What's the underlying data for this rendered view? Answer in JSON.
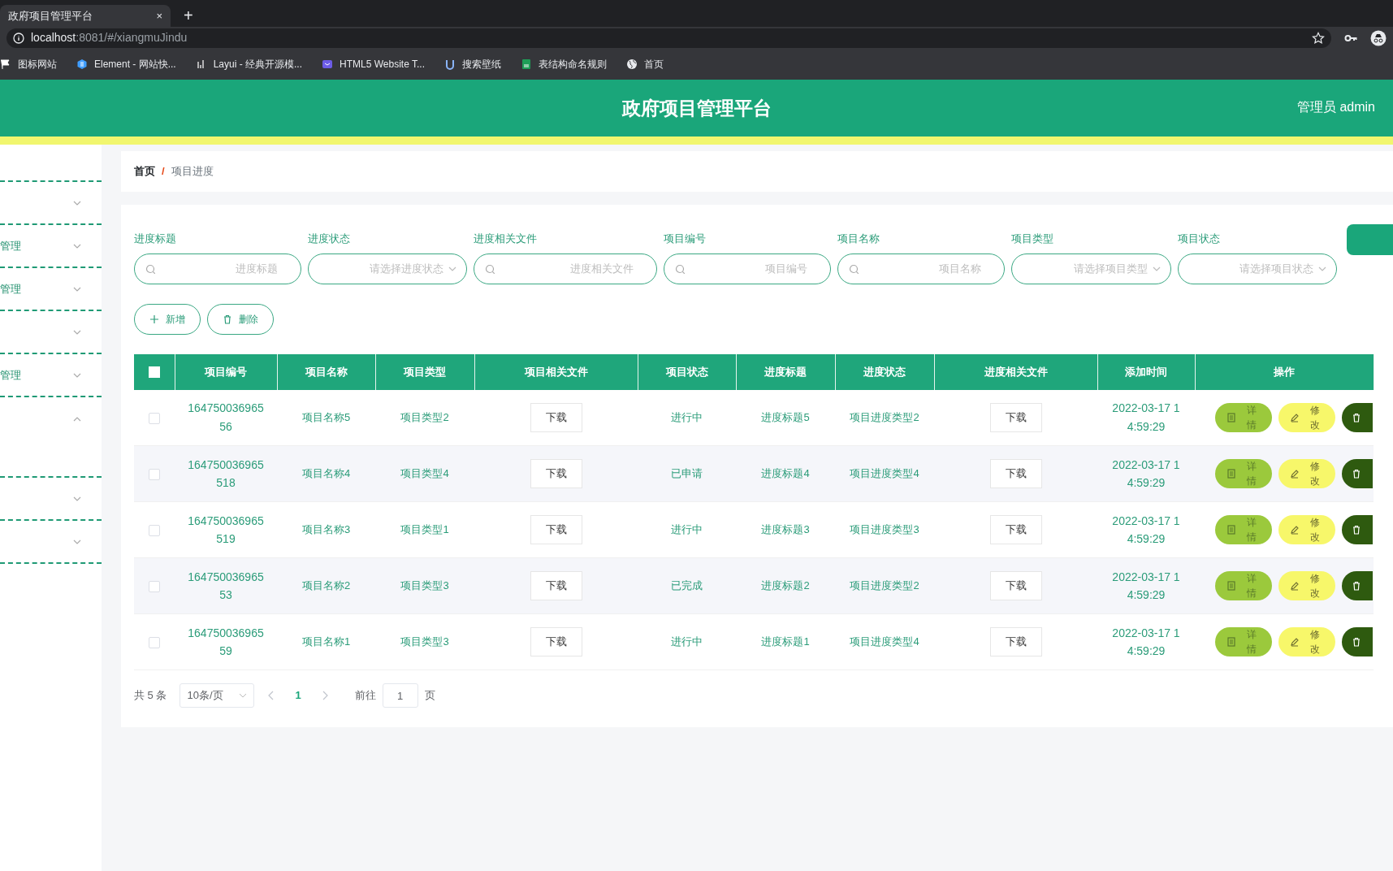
{
  "browser": {
    "tab_title": "政府项目管理平台",
    "tab_close": "×",
    "new_tab": "+",
    "address_host": "localhost",
    "address_rest": ":8081/#/xiangmuJindu",
    "bookmarks": [
      {
        "label": "图标网站",
        "kind": "flag"
      },
      {
        "label": "Element - 网站快...",
        "kind": "hexagon"
      },
      {
        "label": "Layui - 经典开源模...",
        "kind": "bars"
      },
      {
        "label": "HTML5 Website T...",
        "kind": "cat"
      },
      {
        "label": "搜索壁纸",
        "kind": "u"
      },
      {
        "label": "表结构命名规则",
        "kind": "sheet"
      },
      {
        "label": "首页",
        "kind": "globe"
      }
    ]
  },
  "header": {
    "title": "政府项目管理平台",
    "user": "管理员 admin"
  },
  "sidebar": {
    "items": [
      {
        "expanded": false
      },
      {
        "label": "管理",
        "expanded": false
      },
      {
        "label": "管理",
        "expanded": false
      },
      {
        "expanded": false
      },
      {
        "label": "管理",
        "expanded": false
      },
      {
        "expanded": true
      },
      {
        "expanded": false
      },
      {
        "expanded": false
      }
    ]
  },
  "breadcrumb": {
    "items": [
      "首页",
      "项目进度"
    ],
    "separator": "/"
  },
  "filters": [
    {
      "label": "进度标题",
      "placeholder": "进度标题",
      "kind": "search"
    },
    {
      "label": "进度状态",
      "placeholder": "请选择进度状态",
      "kind": "select"
    },
    {
      "label": "进度相关文件",
      "placeholder": "进度相关文件",
      "kind": "search"
    },
    {
      "label": "项目编号",
      "placeholder": "项目编号",
      "kind": "search"
    },
    {
      "label": "项目名称",
      "placeholder": "项目名称",
      "kind": "search"
    },
    {
      "label": "项目类型",
      "placeholder": "请选择项目类型",
      "kind": "select"
    },
    {
      "label": "项目状态",
      "placeholder": "请选择项目状态",
      "kind": "select"
    }
  ],
  "actions": [
    {
      "label": "新增",
      "kind": "add"
    },
    {
      "label": "删除",
      "kind": "delete"
    }
  ],
  "table": {
    "select_all_checked": false,
    "columns": [
      "项目编号",
      "项目名称",
      "项目类型",
      "项目相关文件",
      "项目状态",
      "进度标题",
      "进度状态",
      "进度相关文件",
      "添加时间",
      "操作"
    ],
    "rows": [
      {
        "checked": false,
        "project_no": "16475003696556",
        "project_name": "项目名称5",
        "project_type": "项目类型2",
        "project_file": "下载",
        "project_status": "进行中",
        "progress_title": "进度标题5",
        "progress_status": "项目进度类型2",
        "progress_file": "下载",
        "added_time": "2022-03-17 14:59:29",
        "buttons": [
          {
            "label": "详情",
            "kind": "detail"
          },
          {
            "label": "修改",
            "kind": "edit"
          },
          {
            "kind": "delete"
          }
        ]
      },
      {
        "checked": false,
        "project_no": "164750036965518",
        "project_name": "项目名称4",
        "project_type": "项目类型4",
        "project_file": "下载",
        "project_status": "已申请",
        "progress_title": "进度标题4",
        "progress_status": "项目进度类型4",
        "progress_file": "下载",
        "added_time": "2022-03-17 14:59:29",
        "buttons": [
          {
            "label": "详情",
            "kind": "detail"
          },
          {
            "label": "修改",
            "kind": "edit"
          },
          {
            "kind": "delete"
          }
        ]
      },
      {
        "checked": false,
        "project_no": "164750036965519",
        "project_name": "项目名称3",
        "project_type": "项目类型1",
        "project_file": "下载",
        "project_status": "进行中",
        "progress_title": "进度标题3",
        "progress_status": "项目进度类型3",
        "progress_file": "下载",
        "added_time": "2022-03-17 14:59:29",
        "buttons": [
          {
            "label": "详情",
            "kind": "detail"
          },
          {
            "label": "修改",
            "kind": "edit"
          },
          {
            "kind": "delete"
          }
        ]
      },
      {
        "checked": false,
        "project_no": "16475003696553",
        "project_name": "项目名称2",
        "project_type": "项目类型3",
        "project_file": "下载",
        "project_status": "已完成",
        "progress_title": "进度标题2",
        "progress_status": "项目进度类型2",
        "progress_file": "下载",
        "added_time": "2022-03-17 14:59:29",
        "buttons": [
          {
            "label": "详情",
            "kind": "detail"
          },
          {
            "label": "修改",
            "kind": "edit"
          },
          {
            "kind": "delete"
          }
        ]
      },
      {
        "checked": false,
        "project_no": "16475003696559",
        "project_name": "项目名称1",
        "project_type": "项目类型3",
        "project_file": "下载",
        "project_status": "进行中",
        "progress_title": "进度标题1",
        "progress_status": "项目进度类型4",
        "progress_file": "下载",
        "added_time": "2022-03-17 14:59:29",
        "buttons": [
          {
            "label": "详情",
            "kind": "detail"
          },
          {
            "label": "修改",
            "kind": "edit"
          },
          {
            "kind": "delete"
          }
        ]
      }
    ]
  },
  "pagination": {
    "total": "共 5 条",
    "page_size": "10条/页",
    "pages": [
      {
        "label": "1",
        "selected": true
      }
    ],
    "goto_label": "前往",
    "goto_value": "1",
    "goto_suffix": "页"
  }
}
